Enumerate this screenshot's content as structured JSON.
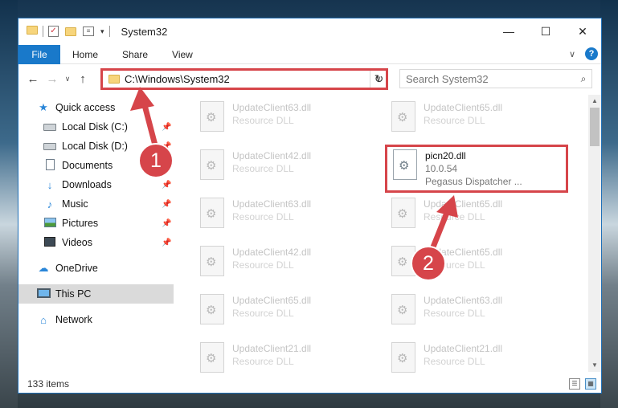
{
  "window": {
    "title": "System32",
    "controls": {
      "minimize": "—",
      "maximize": "☐",
      "close": "✕"
    }
  },
  "ribbon": {
    "tabs": [
      "File",
      "Home",
      "Share",
      "View"
    ]
  },
  "navigation": {
    "back": "←",
    "forward": "→",
    "recent": "∨",
    "up": "↑",
    "address": "C:\\Windows\\System32",
    "search_placeholder": "Search System32"
  },
  "sidebar": {
    "items": [
      {
        "label": "Quick access",
        "icon": "star-icon",
        "pinned": false,
        "selected": false
      },
      {
        "label": "Local Disk (C:)",
        "icon": "disk-icon",
        "pinned": true,
        "selected": false
      },
      {
        "label": "Local Disk (D:)",
        "icon": "disk-icon",
        "pinned": true,
        "selected": false
      },
      {
        "label": "Documents",
        "icon": "documents-icon",
        "pinned": true,
        "selected": false
      },
      {
        "label": "Downloads",
        "icon": "download-icon",
        "pinned": true,
        "selected": false
      },
      {
        "label": "Music",
        "icon": "music-icon",
        "pinned": true,
        "selected": false
      },
      {
        "label": "Pictures",
        "icon": "pictures-icon",
        "pinned": true,
        "selected": false
      },
      {
        "label": "Videos",
        "icon": "videos-icon",
        "pinned": true,
        "selected": false
      },
      {
        "label": "OneDrive",
        "icon": "onedrive-icon",
        "pinned": false,
        "selected": false
      },
      {
        "label": "This PC",
        "icon": "this-pc-icon",
        "pinned": false,
        "selected": true
      },
      {
        "label": "Network",
        "icon": "network-icon",
        "pinned": false,
        "selected": false
      }
    ]
  },
  "files": [
    {
      "name": "UpdateClient63.dll",
      "desc": "Resource DLL"
    },
    {
      "name": "UpdateClient65.dll",
      "desc": "Resource DLL"
    },
    {
      "name": "UpdateClient42.dll",
      "desc": "Resource DLL"
    },
    {
      "name": "picn20.dll",
      "desc": "10.0.54",
      "desc2": "Pegasus Dispatcher ..."
    },
    {
      "name": "UpdateClient63.dll",
      "desc": "Resource DLL"
    },
    {
      "name": "UpdateClient65.dll",
      "desc": "Resource DLL"
    },
    {
      "name": "UpdateClient42.dll",
      "desc": "Resource DLL"
    },
    {
      "name": "UpdateClient65.dll",
      "desc": "Resource DLL"
    },
    {
      "name": "UpdateClient65.dll",
      "desc": "Resource DLL"
    },
    {
      "name": "UpdateClient63.dll",
      "desc": "Resource DLL"
    },
    {
      "name": "UpdateClient21.dll",
      "desc": "Resource DLL"
    },
    {
      "name": "UpdateClient21.dll",
      "desc": "Resource DLL"
    }
  ],
  "status": {
    "item_count": "133 items"
  },
  "callouts": {
    "step1": "1",
    "step2": "2",
    "color": "#d6454a"
  }
}
